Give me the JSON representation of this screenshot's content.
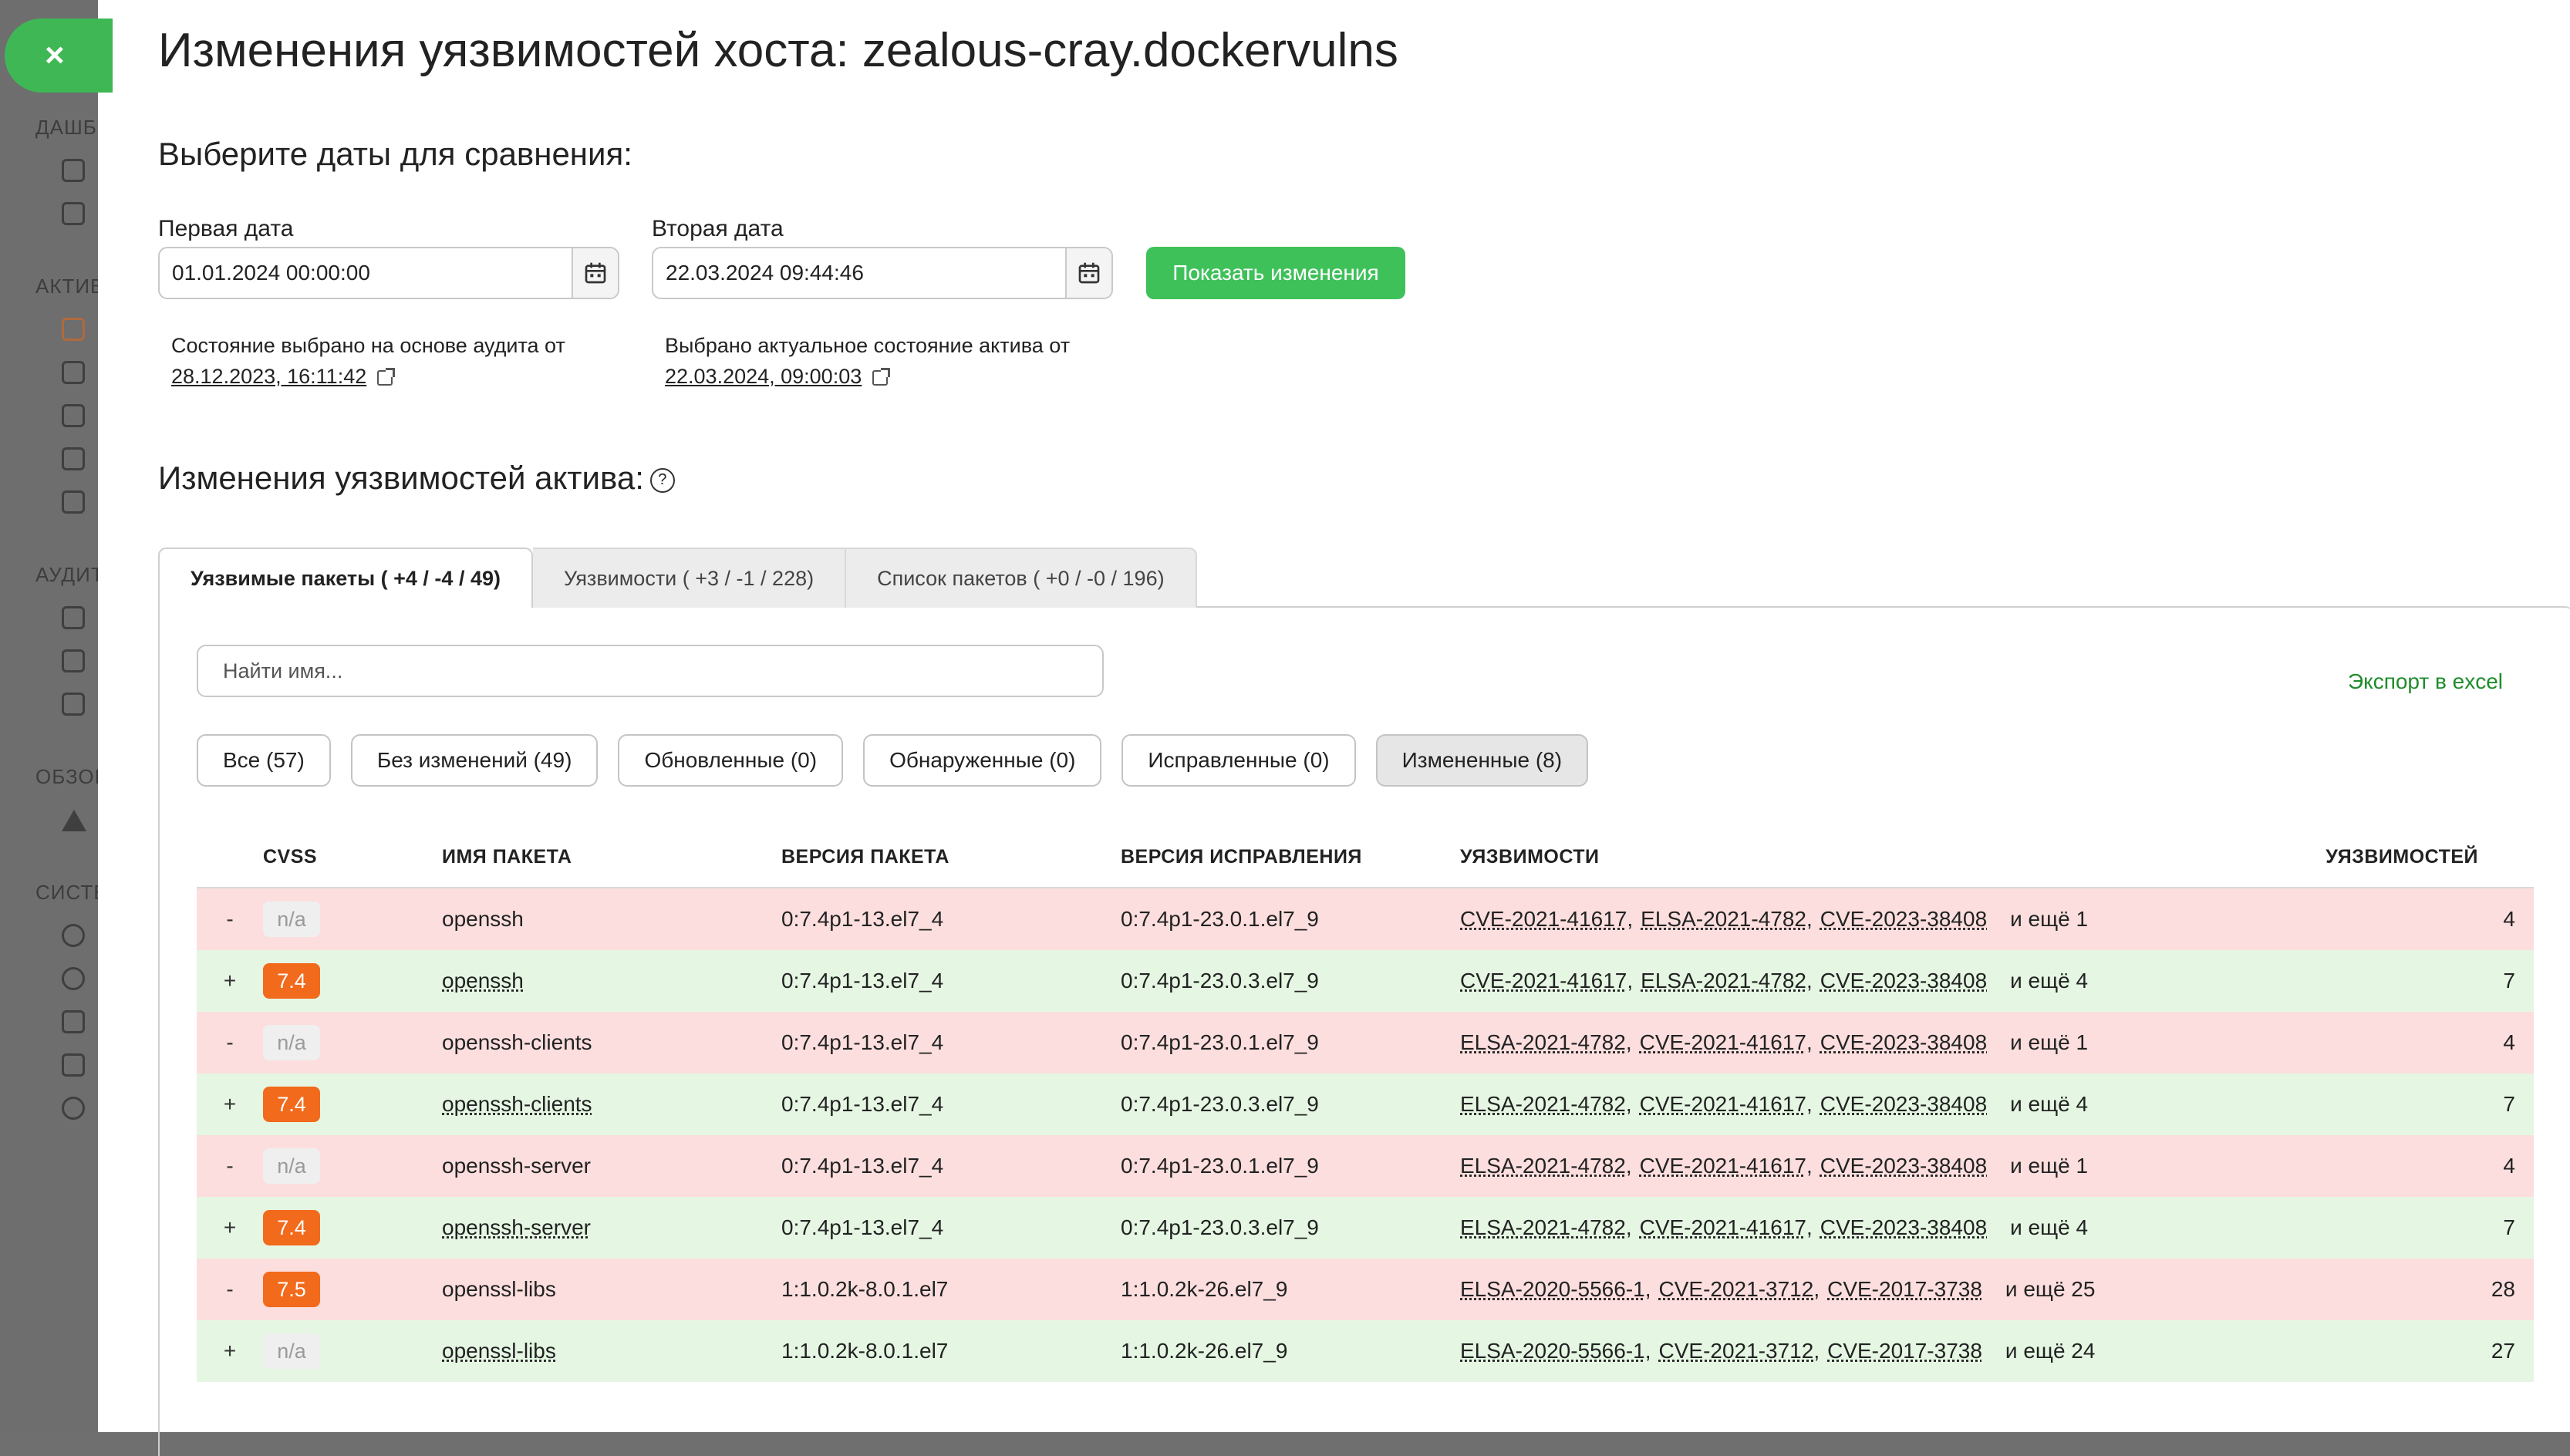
{
  "close_button": "×",
  "sidebar": {
    "sections": [
      "ДАШБ",
      "АКТИВ",
      "АУДИТ",
      "ОБЗОР",
      "СИСТЕ"
    ]
  },
  "page": {
    "title": "Изменения уязвимостей хоста: zealous-cray.dockervulns",
    "dates_heading": "Выберите даты для сравнения:",
    "changes_heading": "Изменения уязвимостей актива:"
  },
  "first_date": {
    "label": "Первая дата",
    "value": "01.01.2024 00:00:00",
    "note": "Состояние выбрано на основе аудита от",
    "note_link": "28.12.2023, 16:11:42"
  },
  "second_date": {
    "label": "Вторая дата",
    "value": "22.03.2024 09:44:46",
    "note": "Выбрано актуальное состояние актива от",
    "note_link": "22.03.2024, 09:00:03"
  },
  "show_changes_button": "Показать изменения",
  "tabs": [
    {
      "label": "Уязвимые пакеты ( +4 / -4 / 49)",
      "active": true
    },
    {
      "label": "Уязвимости ( +3 / -1 / 228)",
      "active": false
    },
    {
      "label": "Список пакетов ( +0 / -0 / 196)",
      "active": false
    }
  ],
  "search": {
    "placeholder": "Найти имя..."
  },
  "export_link": "Экспорт в excel",
  "filters": [
    {
      "label": "Все (57)",
      "selected": false
    },
    {
      "label": "Без изменений (49)",
      "selected": false
    },
    {
      "label": "Обновленные (0)",
      "selected": false
    },
    {
      "label": "Обнаруженные (0)",
      "selected": false
    },
    {
      "label": "Исправленные (0)",
      "selected": false
    },
    {
      "label": "Измененные (8)",
      "selected": true
    }
  ],
  "table": {
    "columns": {
      "cvss": "CVSS",
      "name": "ИМЯ ПАКЕТА",
      "version": "ВЕРСИЯ ПАКЕТА",
      "fix_version": "ВЕРСИЯ ИСПРАВЛЕНИЯ",
      "vulns": "УЯЗВИМОСТИ",
      "count": "УЯЗВИМОСТЕЙ"
    },
    "rows": [
      {
        "sign": "-",
        "cvss": "n/a",
        "name": "openssh",
        "version": "0:7.4p1-13.el7_4",
        "fix": "0:7.4p1-23.0.1.el7_9",
        "vulns": [
          "CVE-2021-41617",
          "ELSA-2021-4782",
          "CVE-2023-38408"
        ],
        "more": "и ещё 1",
        "count": "4"
      },
      {
        "sign": "+",
        "cvss": "7.4",
        "name": "openssh",
        "version": "0:7.4p1-13.el7_4",
        "fix": "0:7.4p1-23.0.3.el7_9",
        "vulns": [
          "CVE-2021-41617",
          "ELSA-2021-4782",
          "CVE-2023-38408"
        ],
        "more": "и ещё 4",
        "count": "7"
      },
      {
        "sign": "-",
        "cvss": "n/a",
        "name": "openssh-clients",
        "version": "0:7.4p1-13.el7_4",
        "fix": "0:7.4p1-23.0.1.el7_9",
        "vulns": [
          "ELSA-2021-4782",
          "CVE-2021-41617",
          "CVE-2023-38408"
        ],
        "more": "и ещё 1",
        "count": "4"
      },
      {
        "sign": "+",
        "cvss": "7.4",
        "name": "openssh-clients",
        "version": "0:7.4p1-13.el7_4",
        "fix": "0:7.4p1-23.0.3.el7_9",
        "vulns": [
          "ELSA-2021-4782",
          "CVE-2021-41617",
          "CVE-2023-38408"
        ],
        "more": "и ещё 4",
        "count": "7"
      },
      {
        "sign": "-",
        "cvss": "n/a",
        "name": "openssh-server",
        "version": "0:7.4p1-13.el7_4",
        "fix": "0:7.4p1-23.0.1.el7_9",
        "vulns": [
          "ELSA-2021-4782",
          "CVE-2021-41617",
          "CVE-2023-38408"
        ],
        "more": "и ещё 1",
        "count": "4"
      },
      {
        "sign": "+",
        "cvss": "7.4",
        "name": "openssh-server",
        "version": "0:7.4p1-13.el7_4",
        "fix": "0:7.4p1-23.0.3.el7_9",
        "vulns": [
          "ELSA-2021-4782",
          "CVE-2021-41617",
          "CVE-2023-38408"
        ],
        "more": "и ещё 4",
        "count": "7"
      },
      {
        "sign": "-",
        "cvss": "7.5",
        "name": "openssl-libs",
        "version": "1:1.0.2k-8.0.1.el7",
        "fix": "1:1.0.2k-26.el7_9",
        "vulns": [
          "ELSA-2020-5566-1",
          "CVE-2021-3712",
          "CVE-2017-3738"
        ],
        "more": "и ещё 25",
        "count": "28"
      },
      {
        "sign": "+",
        "cvss": "n/a",
        "name": "openssl-libs",
        "version": "1:1.0.2k-8.0.1.el7",
        "fix": "1:1.0.2k-26.el7_9",
        "vulns": [
          "ELSA-2020-5566-1",
          "CVE-2021-3712",
          "CVE-2017-3738"
        ],
        "more": "и ещё 24",
        "count": "27"
      }
    ]
  },
  "colors": {
    "accent_green": "#3fc15a",
    "removed_row": "#fcdede",
    "added_row": "#e5f7e3",
    "cvss_high": "#f26a1b",
    "export_link": "#1f8c2b"
  },
  "icons": {
    "close": "close-icon",
    "calendar": "calendar-icon",
    "external": "external-link-icon",
    "help": "help-icon"
  }
}
